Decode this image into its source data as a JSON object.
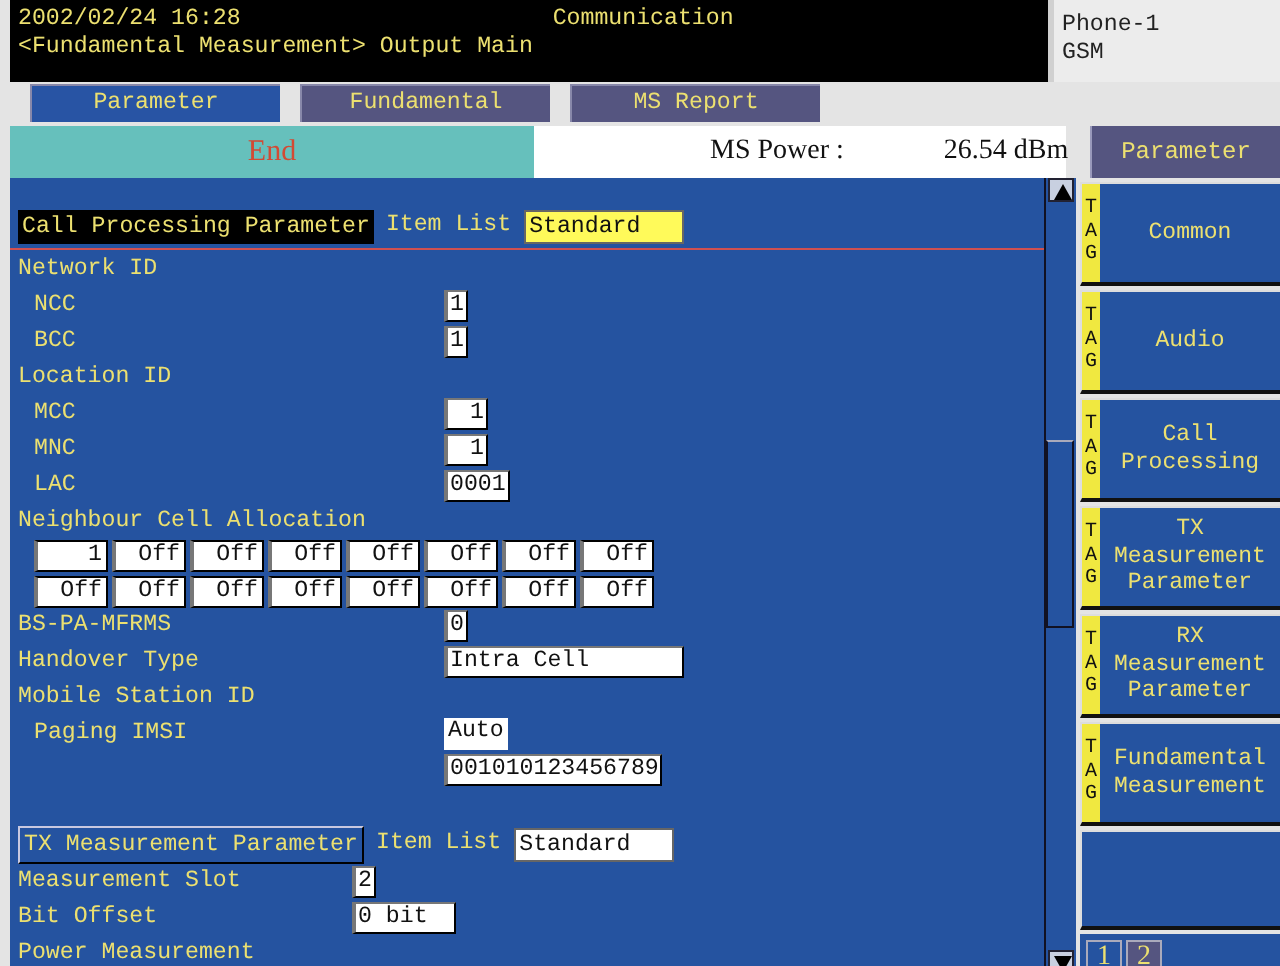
{
  "header": {
    "datetime": "2002/02/24 16:28",
    "title": "Communication",
    "subtitle": "<Fundamental Measurement> Output Main",
    "phone": "Phone-1",
    "system": "GSM"
  },
  "tabs": [
    {
      "label": "Parameter",
      "selected": true
    },
    {
      "label": "Fundamental",
      "selected": false
    },
    {
      "label": "MS Report",
      "selected": false
    }
  ],
  "status": {
    "state": "End",
    "measure_label": "MS Power :",
    "measure_value": "26.54 dBm"
  },
  "sections": [
    {
      "title": "Call Processing Parameter",
      "item_list_label": "Item List",
      "item_list_value": "Standard",
      "selected": true,
      "rows": [
        {
          "kind": "group",
          "label": "Network ID"
        },
        {
          "kind": "item",
          "label": "NCC",
          "value": "1"
        },
        {
          "kind": "item",
          "label": "BCC",
          "value": "1"
        },
        {
          "kind": "group",
          "label": "Location ID"
        },
        {
          "kind": "item",
          "label": "MCC",
          "value": "1",
          "right_aligned": true
        },
        {
          "kind": "item",
          "label": "MNC",
          "value": "1",
          "right_aligned": true
        },
        {
          "kind": "item",
          "label": "LAC",
          "value": "0001"
        },
        {
          "kind": "group",
          "label": "Neighbour Cell Allocation"
        },
        {
          "kind": "grid",
          "cells": [
            "1",
            "Off",
            "Off",
            "Off",
            "Off",
            "Off",
            "Off",
            "Off",
            "Off",
            "Off",
            "Off",
            "Off",
            "Off",
            "Off",
            "Off",
            "Off"
          ]
        },
        {
          "kind": "field",
          "label": "BS-PA-MFRMS",
          "value": "0"
        },
        {
          "kind": "field",
          "label": "Handover Type",
          "value": "Intra Cell",
          "wide": true
        },
        {
          "kind": "group",
          "label": "Mobile Station ID"
        },
        {
          "kind": "item",
          "label": "Paging IMSI",
          "value": "Auto",
          "plain": true
        },
        {
          "kind": "value",
          "value": "001010123456789"
        }
      ]
    },
    {
      "title": "TX Measurement Parameter",
      "item_list_label": "Item List",
      "item_list_value": "Standard",
      "selected": false,
      "rows": [
        {
          "kind": "field",
          "label": "Measurement Slot",
          "value": "2"
        },
        {
          "kind": "field",
          "label": "Bit Offset",
          "value": "0 bit",
          "wide": true
        },
        {
          "kind": "group",
          "label": "Power Measurement"
        }
      ]
    }
  ],
  "sidebar": {
    "title": "Parameter",
    "items": [
      {
        "tag": "TAG",
        "label": "Common"
      },
      {
        "tag": "TAG",
        "label": "Audio"
      },
      {
        "tag": "TAG",
        "label": "Call\nProcessing"
      },
      {
        "tag": "TAG",
        "label": "TX\nMeasurement\nParameter"
      },
      {
        "tag": "TAG",
        "label": "RX\nMeasurement\nParameter"
      },
      {
        "tag": "TAG",
        "label": "Fundamental\nMeasurement"
      }
    ],
    "pages": [
      {
        "label": "1",
        "selected": true
      },
      {
        "label": "2",
        "selected": false
      }
    ]
  }
}
